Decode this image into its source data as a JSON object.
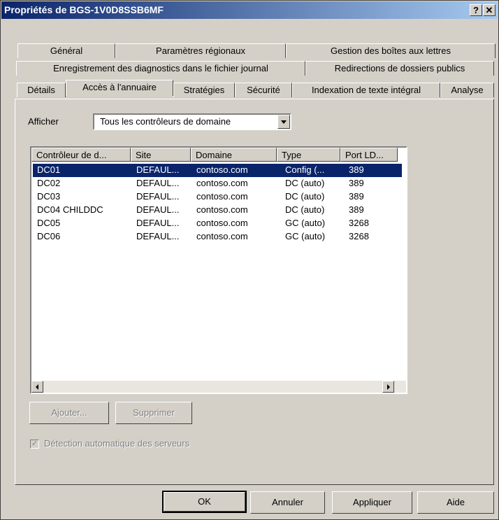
{
  "window": {
    "title": "Propriétés de BGS-1V0D8SSB6MF",
    "help_glyph": "?",
    "close_glyph": "✕"
  },
  "tabs": {
    "row1": [
      "Général",
      "Paramètres régionaux",
      "Gestion des boîtes aux lettres"
    ],
    "row2": [
      "Enregistrement des diagnostics dans le fichier journal",
      "Redirections de dossiers publics"
    ],
    "row3": [
      "Détails",
      "Accès à l'annuaire",
      "Stratégies",
      "Sécurité",
      "Indexation de texte intégral",
      "Analyse"
    ],
    "active": "Accès à l'annuaire"
  },
  "filter": {
    "label": "Afficher",
    "selected": "Tous les contrôleurs de domaine"
  },
  "list": {
    "columns": [
      "Contrôleur de d...",
      "Site",
      "Domaine",
      "Type",
      "Port LD..."
    ],
    "rows": [
      {
        "dc": "DC01",
        "site": "DEFAUL...",
        "domain": "contoso.com",
        "type": "Config (...",
        "port": "389",
        "selected": true
      },
      {
        "dc": "DC02",
        "site": "DEFAUL...",
        "domain": "contoso.com",
        "type": "DC (auto)",
        "port": "389"
      },
      {
        "dc": "DC03",
        "site": "DEFAUL...",
        "domain": "contoso.com",
        "type": "DC (auto)",
        "port": "389"
      },
      {
        "dc": "DC04 CHILDDC",
        "site": "DEFAUL...",
        "domain": "contoso.com",
        "type": "DC (auto)",
        "port": "389"
      },
      {
        "dc": "DC05",
        "site": "DEFAUL...",
        "domain": "contoso.com",
        "type": "GC (auto)",
        "port": "3268"
      },
      {
        "dc": "DC06",
        "site": "DEFAUL...",
        "domain": "contoso.com",
        "type": "GC (auto)",
        "port": "3268"
      }
    ]
  },
  "actions": {
    "add": "Ajouter...",
    "remove": "Supprimer"
  },
  "auto_detect": {
    "label": "Détection automatique des serveurs",
    "checked": true
  },
  "footer": {
    "ok": "OK",
    "cancel": "Annuler",
    "apply": "Appliquer",
    "help": "Aide"
  },
  "colors": {
    "selection": "#0a246a",
    "title_start": "#0a246a",
    "title_end": "#a6caf0",
    "face": "#d4d0c8"
  }
}
